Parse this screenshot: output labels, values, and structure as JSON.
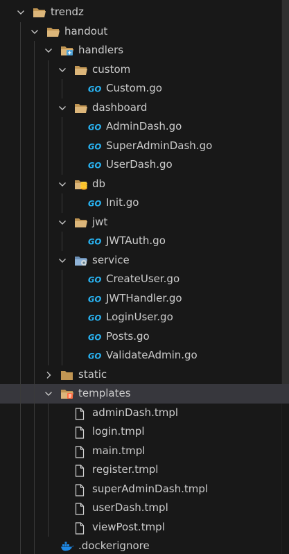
{
  "explorer": {
    "items": [
      {
        "label": "trendz",
        "kind": "folder-open",
        "depth": 0
      },
      {
        "label": "handout",
        "kind": "folder-open",
        "depth": 1
      },
      {
        "label": "handlers",
        "kind": "folder-handlers-open",
        "depth": 2
      },
      {
        "label": "custom",
        "kind": "folder-open",
        "depth": 3
      },
      {
        "label": "Custom.go",
        "kind": "go-file",
        "depth": 4
      },
      {
        "label": "dashboard",
        "kind": "folder-open",
        "depth": 3
      },
      {
        "label": "AdminDash.go",
        "kind": "go-file",
        "depth": 4
      },
      {
        "label": "SuperAdminDash.go",
        "kind": "go-file",
        "depth": 4
      },
      {
        "label": "UserDash.go",
        "kind": "go-file",
        "depth": 4
      },
      {
        "label": "db",
        "kind": "folder-db-open",
        "depth": 3
      },
      {
        "label": "Init.go",
        "kind": "go-file",
        "depth": 4
      },
      {
        "label": "jwt",
        "kind": "folder-open",
        "depth": 3
      },
      {
        "label": "JWTAuth.go",
        "kind": "go-file",
        "depth": 4
      },
      {
        "label": "service",
        "kind": "folder-service-open",
        "depth": 3
      },
      {
        "label": "CreateUser.go",
        "kind": "go-file",
        "depth": 4
      },
      {
        "label": "JWTHandler.go",
        "kind": "go-file",
        "depth": 4
      },
      {
        "label": "LoginUser.go",
        "kind": "go-file",
        "depth": 4
      },
      {
        "label": "Posts.go",
        "kind": "go-file",
        "depth": 4
      },
      {
        "label": "ValidateAdmin.go",
        "kind": "go-file",
        "depth": 4
      },
      {
        "label": "static",
        "kind": "folder-closed",
        "depth": 2
      },
      {
        "label": "templates",
        "kind": "folder-templates-open",
        "depth": 2,
        "selected": true
      },
      {
        "label": "adminDash.tmpl",
        "kind": "tmpl-file",
        "depth": 3
      },
      {
        "label": "login.tmpl",
        "kind": "tmpl-file",
        "depth": 3
      },
      {
        "label": "main.tmpl",
        "kind": "tmpl-file",
        "depth": 3
      },
      {
        "label": "register.tmpl",
        "kind": "tmpl-file",
        "depth": 3
      },
      {
        "label": "superAdminDash.tmpl",
        "kind": "tmpl-file",
        "depth": 3
      },
      {
        "label": "userDash.tmpl",
        "kind": "tmpl-file",
        "depth": 3
      },
      {
        "label": "viewPost.tmpl",
        "kind": "tmpl-file",
        "depth": 3
      },
      {
        "label": ".dockerignore",
        "kind": "docker-file",
        "depth": 2
      }
    ]
  },
  "colors": {
    "background": "#181818",
    "text": "#cccccc",
    "selected_row": "#37373d",
    "folder": "#c09553",
    "go_icon": "#29b6f6",
    "docker_icon": "#1e88e5"
  }
}
